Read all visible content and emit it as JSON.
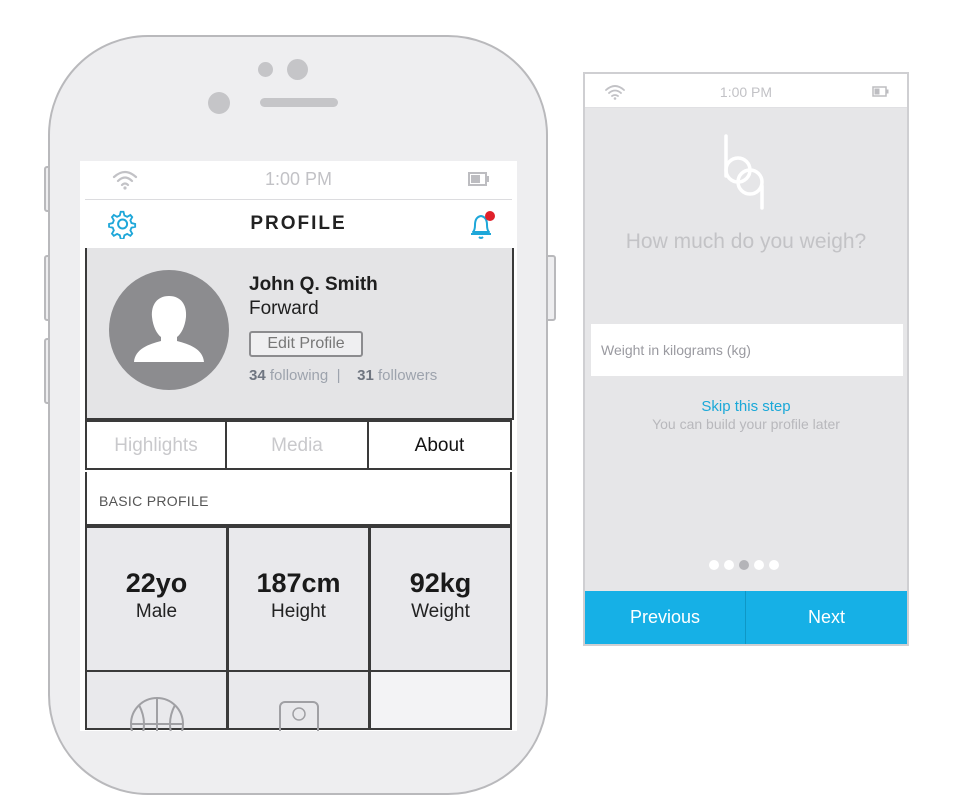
{
  "profile_screen": {
    "status_time": "1:00 PM",
    "title": "PROFILE",
    "user": {
      "name": "John Q. Smith",
      "position": "Forward",
      "edit_label": "Edit Profile",
      "following_count": "34",
      "following_label": "following",
      "separator": "|",
      "followers_count": "31",
      "followers_label": "followers"
    },
    "tabs": [
      {
        "label": "Highlights",
        "active": false
      },
      {
        "label": "Media",
        "active": false
      },
      {
        "label": "About",
        "active": true
      }
    ],
    "section_title": "BASIC PROFILE",
    "stats": [
      {
        "value": "22yo",
        "label": "Male"
      },
      {
        "value": "187cm",
        "label": "Height"
      },
      {
        "value": "92kg",
        "label": "Weight"
      }
    ],
    "icons": [
      "wifi-icon",
      "battery-icon",
      "gear-icon",
      "bell-icon",
      "avatar-silhouette-icon",
      "basketball-icon",
      "court-icon"
    ],
    "notification_dot_color": "#e0202a"
  },
  "onboarding_screen": {
    "status_time": "1:00 PM",
    "question": "How much do you weigh?",
    "weight_placeholder": "Weight in kilograms (kg)",
    "skip_label": "Skip this step",
    "skip_hint": "You can build your profile later",
    "step_current": 3,
    "step_total": 5,
    "previous_label": "Previous",
    "next_label": "Next",
    "accent_color": "#16b0e6"
  }
}
